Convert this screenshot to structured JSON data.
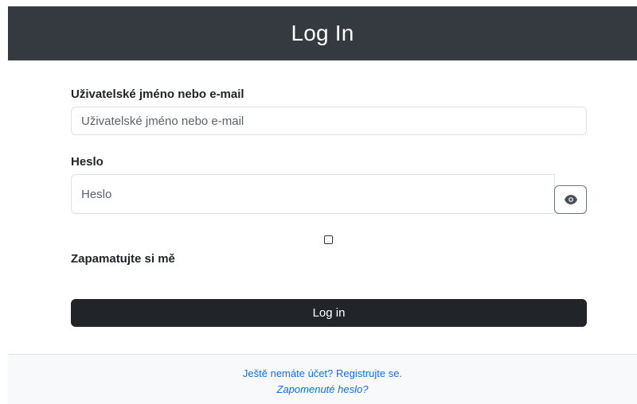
{
  "header": {
    "title": "Log In"
  },
  "form": {
    "username": {
      "label": "Uživatelské jméno nebo e-mail",
      "placeholder": "Uživatelské jméno nebo e-mail",
      "value": ""
    },
    "password": {
      "label": "Heslo",
      "placeholder": "Heslo",
      "value": ""
    },
    "remember": {
      "label": "Zapamatujte si mě",
      "checked": false
    },
    "submit_label": "Log in",
    "icons": {
      "toggle_password": "eye-icon"
    }
  },
  "footer": {
    "register_link": "Ještě nemáte účet? Registrujte se.",
    "forgot_link": "Zapomenuté heslo?"
  },
  "colors": {
    "header_bg": "#343a40",
    "button_bg": "#212529",
    "link": "#0d6efd",
    "footer_bg": "#f8f9fa"
  }
}
